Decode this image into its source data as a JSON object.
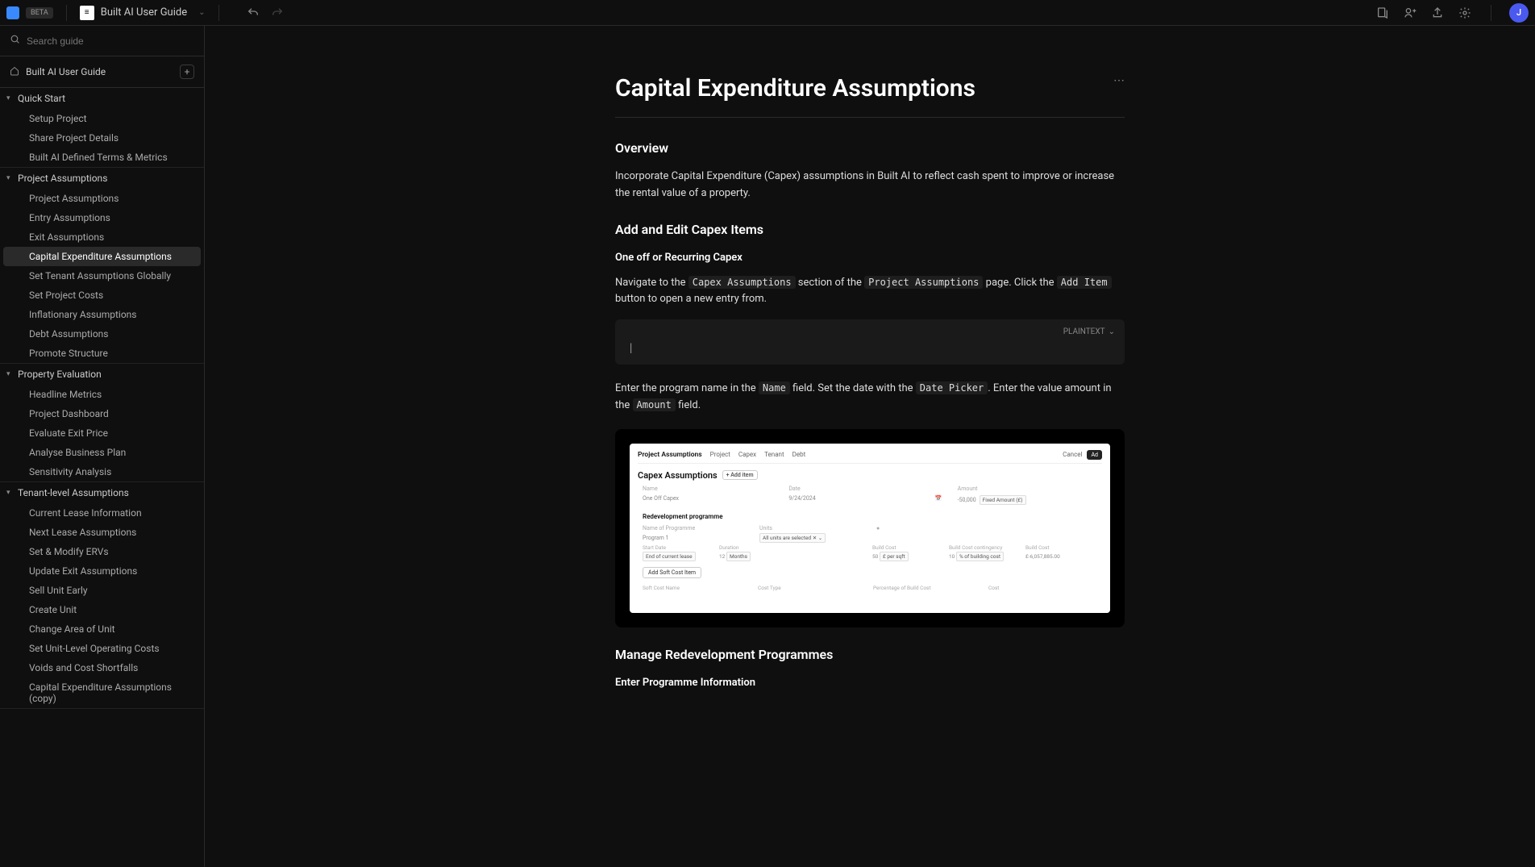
{
  "header": {
    "beta_label": "BETA",
    "doc_title": "Built AI User Guide",
    "avatar_initial": "J"
  },
  "search": {
    "placeholder": "Search guide"
  },
  "guide": {
    "title": "Built AI User Guide"
  },
  "nav": {
    "sections": [
      {
        "title": "Quick Start",
        "items": [
          "Setup Project",
          "Share Project Details",
          "Built AI Defined Terms & Metrics"
        ]
      },
      {
        "title": "Project Assumptions",
        "items": [
          "Project Assumptions",
          "Entry Assumptions",
          "Exit Assumptions",
          "Capital Expenditure Assumptions",
          "Set Tenant Assumptions Globally",
          "Set Project Costs",
          "Inflationary Assumptions",
          "Debt Assumptions",
          "Promote Structure"
        ],
        "active_index": 3
      },
      {
        "title": "Property Evaluation",
        "items": [
          "Headline Metrics",
          "Project Dashboard",
          "Evaluate Exit Price",
          "Analyse Business Plan",
          "Sensitivity Analysis"
        ]
      },
      {
        "title": "Tenant-level Assumptions",
        "items": [
          "Current Lease Information",
          "Next Lease Assumptions",
          "Set & Modify ERVs",
          "Update Exit Assumptions",
          "Sell Unit Early",
          "Create Unit",
          "Change Area of Unit",
          "Set Unit-Level Operating Costs",
          "Voids and Cost Shortfalls",
          "Capital Expenditure Assumptions (copy)"
        ]
      }
    ]
  },
  "article": {
    "title": "Capital Expenditure Assumptions",
    "overview_h": "Overview",
    "overview_p": "Incorporate Capital Expenditure (Capex) assumptions in Built AI to reflect cash spent to improve or increase the rental value of a property.",
    "add_edit_h": "Add and Edit Capex Items",
    "one_off_h": "One off or Recurring Capex",
    "nav_p_1": "Navigate to the ",
    "nav_p_code1": "Capex Assumptions",
    "nav_p_2": " section of the ",
    "nav_p_code2": "Project Assumptions",
    "nav_p_3": " page. Click the ",
    "nav_p_code3": "Add Item",
    "nav_p_4": " button to open a new entry from.",
    "code_lang": "PLAINTEXT",
    "code_content": "|",
    "enter_p_1": "Enter the program name in the ",
    "enter_p_code1": "Name",
    "enter_p_2": " field.  Set the date with the ",
    "enter_p_code2": "Date Picker",
    "enter_p_3": ". Enter the value amount in the ",
    "enter_p_code3": "Amount",
    "enter_p_4": " field.",
    "manage_h": "Manage Redevelopment Programmes",
    "enter_prog_h": "Enter Programme Information"
  },
  "mock": {
    "topbar_title": "Project Assumptions",
    "tabs": [
      "Project",
      "Capex",
      "Tenant",
      "Debt"
    ],
    "cancel": "Cancel",
    "add": "Ad",
    "section_title": "Capex Assumptions",
    "add_item": "+ Add item",
    "cols": [
      "Name",
      "Date",
      "",
      "Amount"
    ],
    "row": {
      "name": "One Off Capex",
      "date": "9/24/2024",
      "amount": "-50,000",
      "amount_type": "Fixed Amount (£)"
    },
    "redev_h": "Redevelopment programme",
    "prog_cols": [
      "Name of Programme",
      "Units"
    ],
    "prog_row": {
      "name": "Program 1",
      "units": "All units are selected"
    },
    "detail_cols": [
      "Start Date",
      "Duration",
      "",
      "Build Cost",
      "Build Cost contingency",
      "Build Cost"
    ],
    "detail_row": {
      "start": "End of current lease",
      "dur_n": "12",
      "dur_u": "Months",
      "bc_n": "50",
      "bc_u": "£ per sqft",
      "cont_n": "10",
      "cont_u": "% of building cost",
      "total": "£-6,057,885.00"
    },
    "soft_btn": "Add Soft Cost Item",
    "foot_cols": [
      "Soft Cost Name",
      "Cost Type",
      "Percentage of Build Cost",
      "Cost"
    ]
  }
}
